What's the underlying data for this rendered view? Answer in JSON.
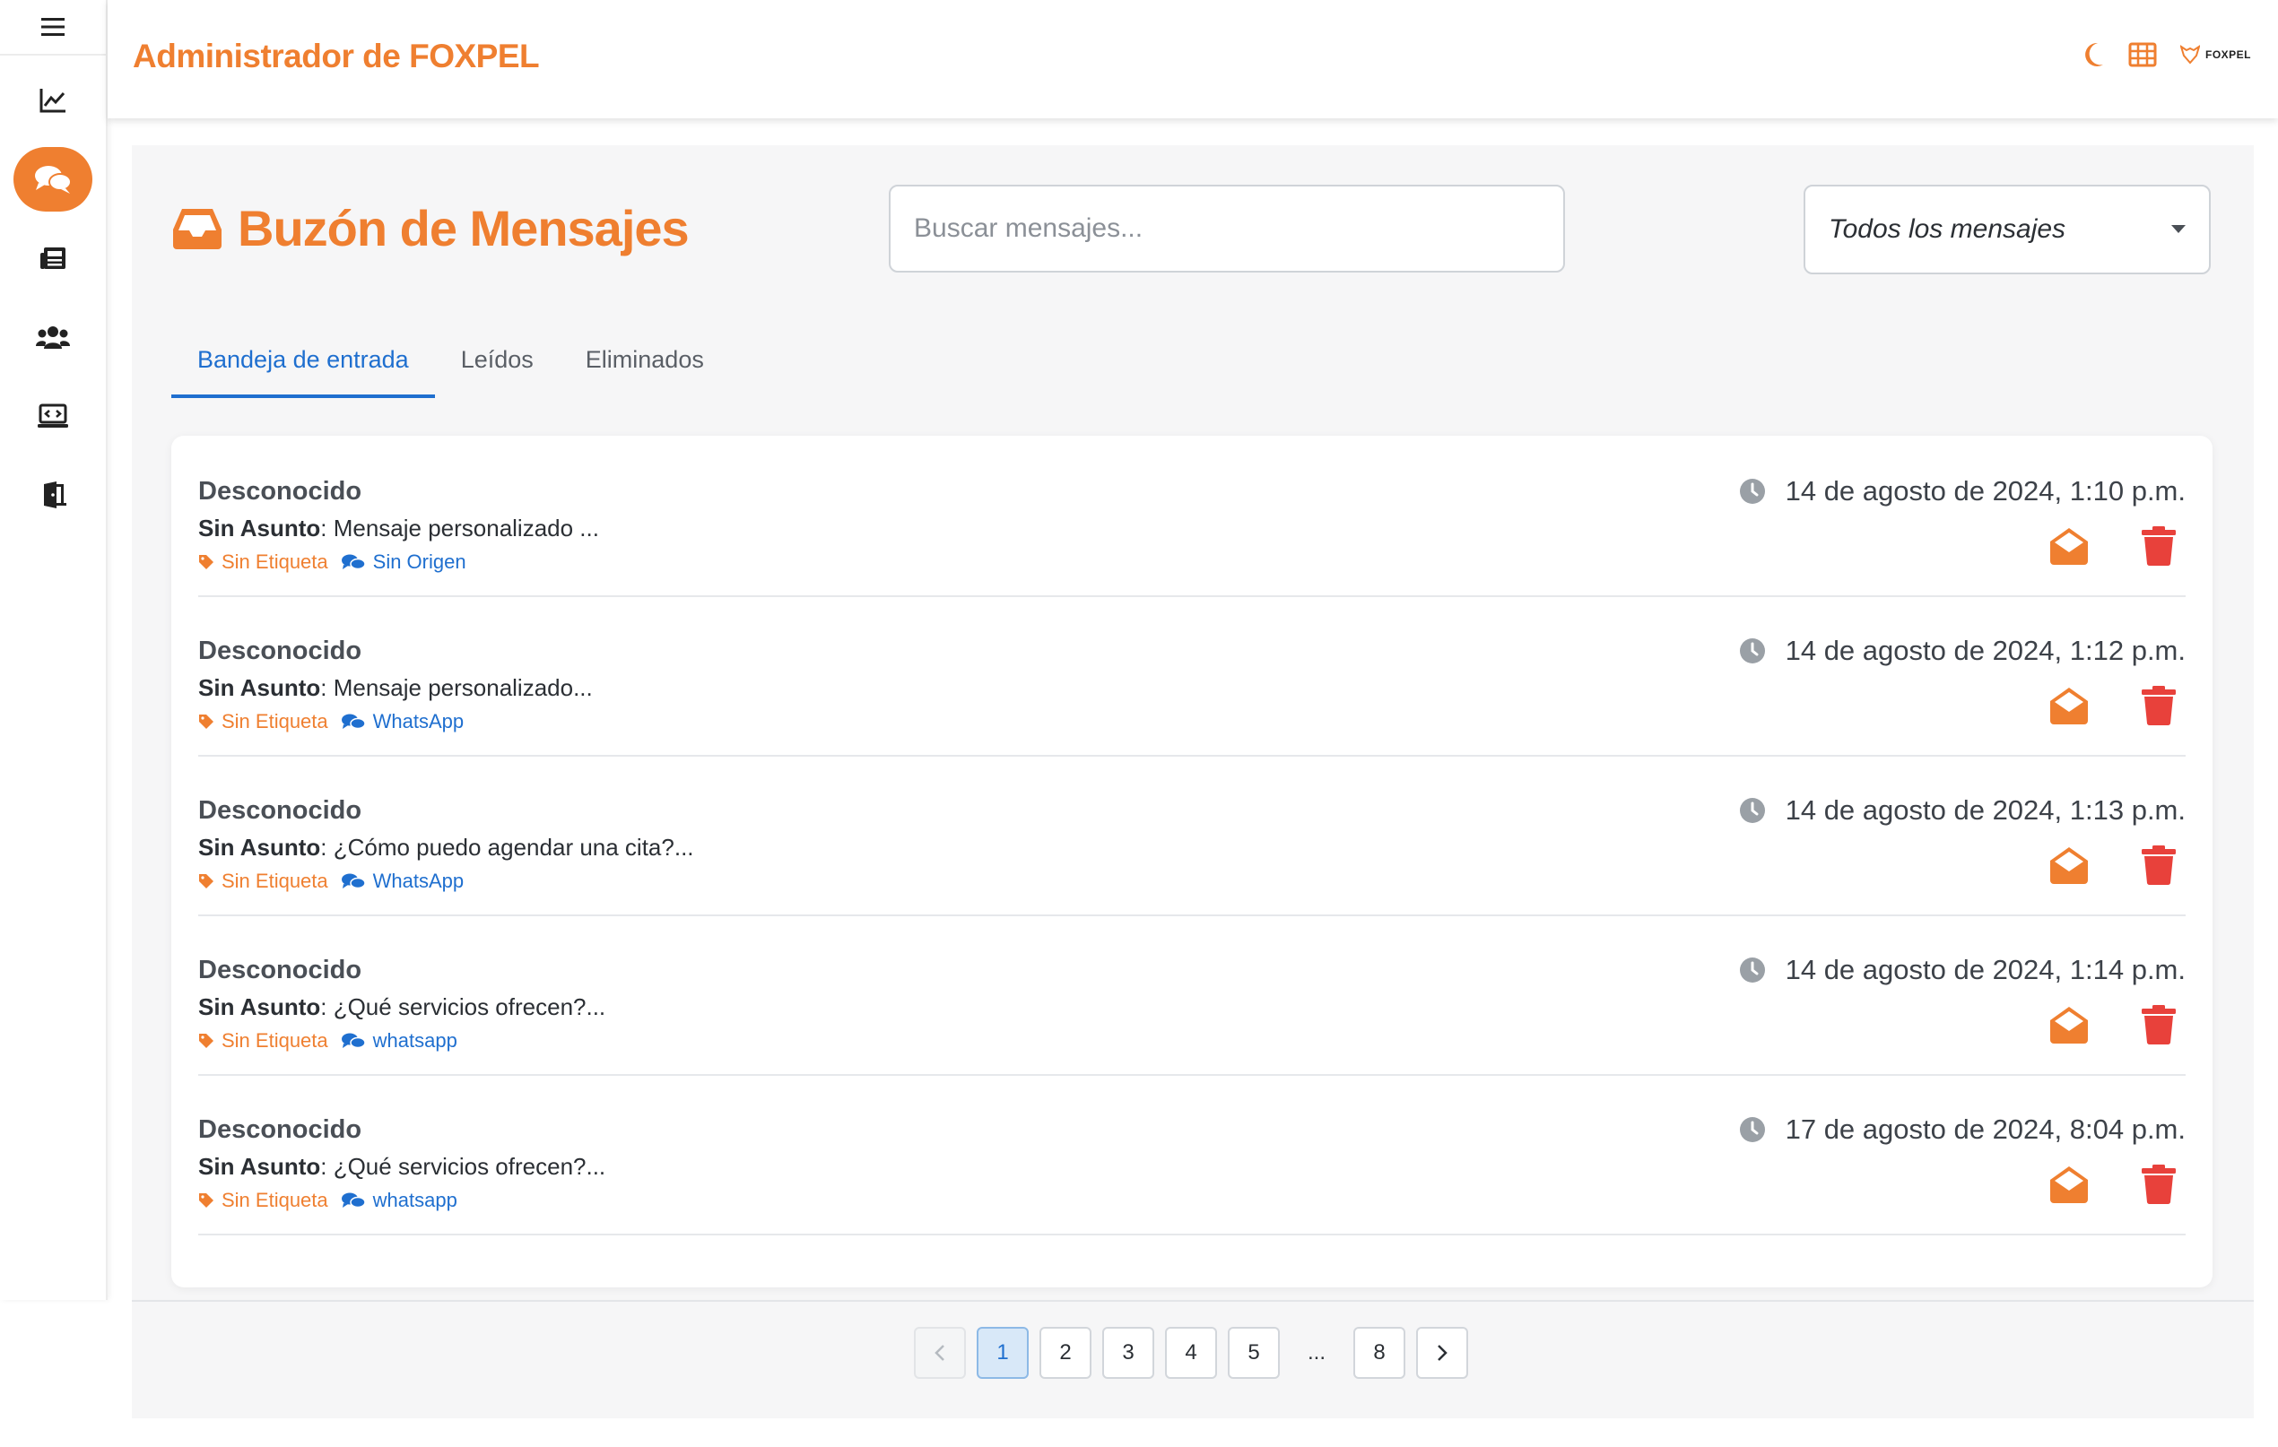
{
  "app": {
    "title": "Administrador de FOXPEL",
    "logo_text": "FOXPEL"
  },
  "colors": {
    "accent": "#ef7f30",
    "link": "#1f6fcf",
    "danger": "#e8413b",
    "muted": "#9aa0a6"
  },
  "sidebar": {
    "items": [
      {
        "icon": "chart-line-icon"
      },
      {
        "icon": "comments-icon",
        "active": true
      },
      {
        "icon": "newspaper-icon"
      },
      {
        "icon": "users-icon"
      },
      {
        "icon": "laptop-code-icon"
      },
      {
        "icon": "door-exit-icon"
      }
    ]
  },
  "header": {
    "icons": [
      "moon-icon",
      "table-icon",
      "foxpel-logo"
    ]
  },
  "page": {
    "title": "Buzón de Mensajes",
    "search": {
      "placeholder": "Buscar mensajes...",
      "value": ""
    },
    "filter": {
      "selected": "Todos los mensajes"
    },
    "tabs": [
      {
        "label": "Bandeja de entrada",
        "active": true
      },
      {
        "label": "Leídos",
        "active": false
      },
      {
        "label": "Eliminados",
        "active": false
      }
    ]
  },
  "messages": [
    {
      "sender": "Desconocido",
      "subject_label": "Sin Asunto",
      "preview": ": Mensaje personalizado ...",
      "tag": "Sin Etiqueta",
      "source": "Sin Origen",
      "date": "14 de agosto de 2024, 1:10 p.m."
    },
    {
      "sender": "Desconocido",
      "subject_label": "Sin Asunto",
      "preview": ": Mensaje personalizado...",
      "tag": "Sin Etiqueta",
      "source": "WhatsApp",
      "date": "14 de agosto de 2024, 1:12 p.m."
    },
    {
      "sender": "Desconocido",
      "subject_label": "Sin Asunto",
      "preview": ": ¿Cómo puedo agendar una cita?...",
      "tag": "Sin Etiqueta",
      "source": "WhatsApp",
      "date": "14 de agosto de 2024, 1:13 p.m."
    },
    {
      "sender": "Desconocido",
      "subject_label": "Sin Asunto",
      "preview": ": ¿Qué servicios ofrecen?...",
      "tag": "Sin Etiqueta",
      "source": "whatsapp",
      "date": "14 de agosto de 2024, 1:14 p.m."
    },
    {
      "sender": "Desconocido",
      "subject_label": "Sin Asunto",
      "preview": ": ¿Qué servicios ofrecen?...",
      "tag": "Sin Etiqueta",
      "source": "whatsapp",
      "date": "17 de agosto de 2024, 8:04 p.m."
    }
  ],
  "pagination": {
    "current": 1,
    "pages": [
      "1",
      "2",
      "3",
      "4",
      "5",
      "...",
      "8"
    ]
  }
}
